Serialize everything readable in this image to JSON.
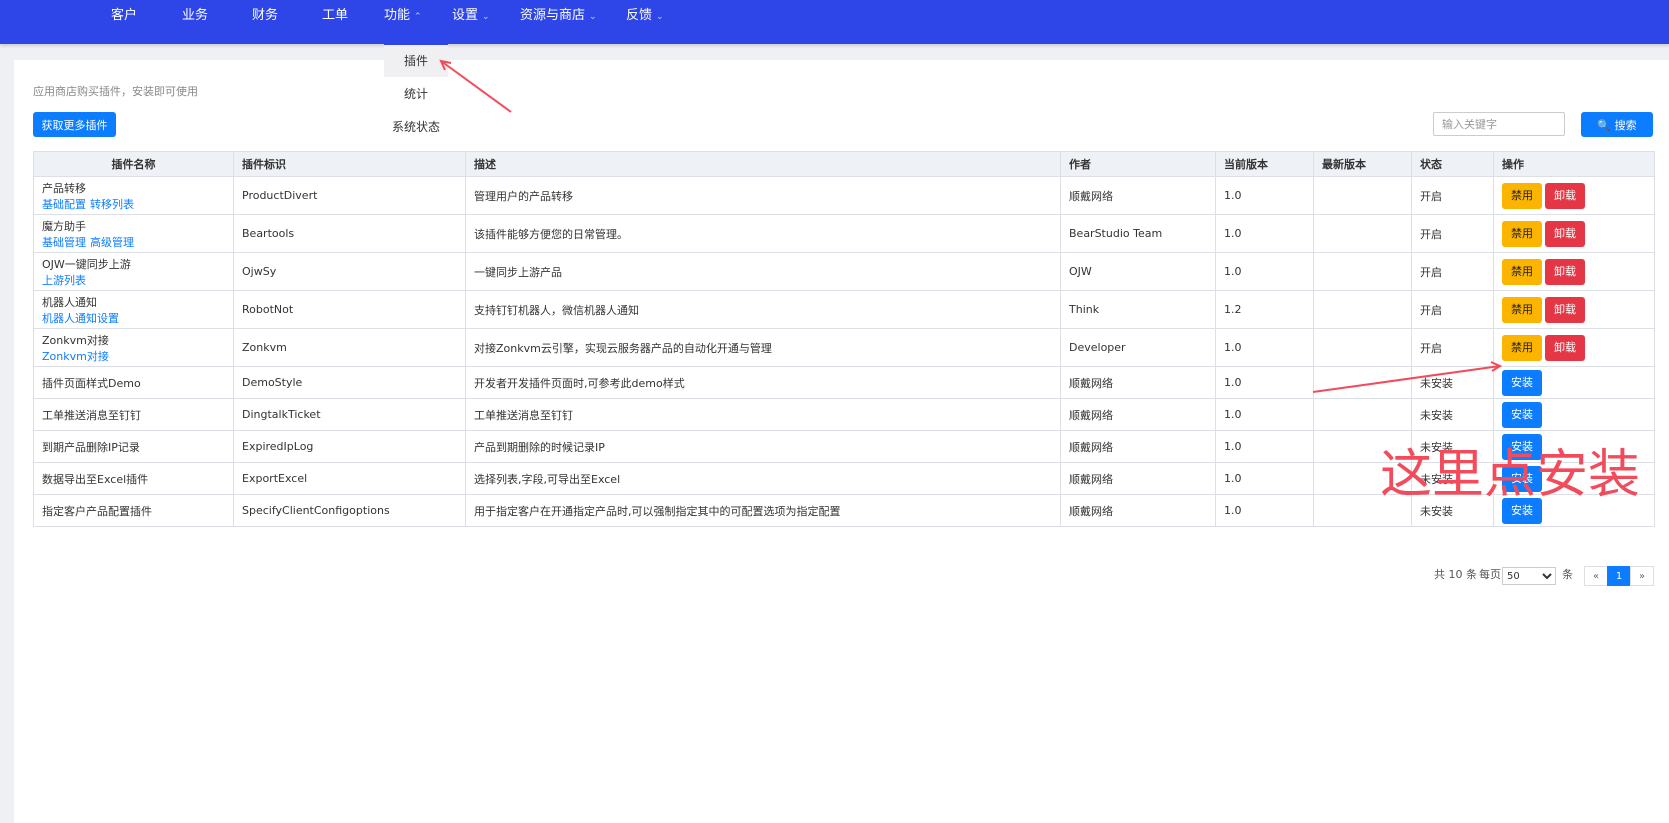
{
  "nav": {
    "items": [
      {
        "label": "客户",
        "chevron": false
      },
      {
        "label": "业务",
        "chevron": false
      },
      {
        "label": "财务",
        "chevron": false
      },
      {
        "label": "工单",
        "chevron": false
      },
      {
        "label": "功能",
        "chevron": true,
        "open": true
      },
      {
        "label": "设置",
        "chevron": true
      },
      {
        "label": "资源与商店",
        "chevron": true
      },
      {
        "label": "反馈",
        "chevron": true
      }
    ],
    "dropdown": [
      "插件",
      "统计",
      "系统状态"
    ]
  },
  "page": {
    "hint": "应用商店购买插件，安装即可使用",
    "get_more_label": "获取更多插件",
    "search_placeholder": "输入关键字",
    "search_label": "搜索"
  },
  "table": {
    "columns": [
      "插件名称",
      "插件标识",
      "描述",
      "作者",
      "当前版本",
      "最新版本",
      "状态",
      "操作"
    ],
    "actions": {
      "disable": "禁用",
      "uninstall": "卸载",
      "install": "安装"
    },
    "rows": [
      {
        "name": "产品转移",
        "links": [
          "基础配置",
          "转移列表"
        ],
        "id": "ProductDivert",
        "desc": "管理用户的产品转移",
        "author": "顺戴网络",
        "version": "1.0",
        "latest": "",
        "status": "开启",
        "installed": true
      },
      {
        "name": "魔方助手",
        "links": [
          "基础管理",
          "高级管理"
        ],
        "id": "Beartools",
        "desc": "该插件能够方便您的日常管理。",
        "author": "BearStudio Team",
        "version": "1.0",
        "latest": "",
        "status": "开启",
        "installed": true
      },
      {
        "name": "OJW一键同步上游",
        "links": [
          "上游列表"
        ],
        "id": "OjwSy",
        "desc": "一键同步上游产品",
        "author": "OJW",
        "version": "1.0",
        "latest": "",
        "status": "开启",
        "installed": true
      },
      {
        "name": "机器人通知",
        "links": [
          "机器人通知设置"
        ],
        "id": "RobotNot",
        "desc": "支持钉钉机器人，微信机器人通知",
        "author": "Think",
        "version": "1.2",
        "latest": "",
        "status": "开启",
        "installed": true
      },
      {
        "name": "Zonkvm对接",
        "links": [
          "Zonkvm对接"
        ],
        "id": "Zonkvm",
        "desc": "对接Zonkvm云引擎，实现云服务器产品的自动化开通与管理",
        "author": "Developer",
        "version": "1.0",
        "latest": "",
        "status": "开启",
        "installed": true
      },
      {
        "name": "插件页面样式Demo",
        "links": [],
        "id": "DemoStyle",
        "desc": "开发者开发插件页面时,可参考此demo样式",
        "author": "顺戴网络",
        "version": "1.0",
        "latest": "",
        "status": "未安装",
        "installed": false
      },
      {
        "name": "工单推送消息至钉钉",
        "links": [],
        "id": "DingtalkTicket",
        "desc": "工单推送消息至钉钉",
        "author": "顺戴网络",
        "version": "1.0",
        "latest": "",
        "status": "未安装",
        "installed": false
      },
      {
        "name": "到期产品删除IP记录",
        "links": [],
        "id": "ExpiredIpLog",
        "desc": "产品到期删除的时候记录IP",
        "author": "顺戴网络",
        "version": "1.0",
        "latest": "",
        "status": "未安装",
        "installed": false
      },
      {
        "name": "数据导出至Excel插件",
        "links": [],
        "id": "ExportExcel",
        "desc": "选择列表,字段,可导出至Excel",
        "author": "顺戴网络",
        "version": "1.0",
        "latest": "",
        "status": "未安装",
        "installed": false
      },
      {
        "name": "指定客户产品配置插件",
        "links": [],
        "id": "SpecifyClientConfigoptions",
        "desc": "用于指定客户在开通指定产品时,可以强制指定其中的可配置选项为指定配置",
        "author": "顺戴网络",
        "version": "1.0",
        "latest": "",
        "status": "未安装",
        "installed": false
      }
    ]
  },
  "pager": {
    "total": "共 10 条",
    "per_page_label": "每页",
    "per_page_value": "50",
    "unit": "条",
    "prev": "«",
    "current": "1",
    "next": "»"
  },
  "annotation": {
    "text": "这里点安装",
    "color": "#f24b5c"
  }
}
